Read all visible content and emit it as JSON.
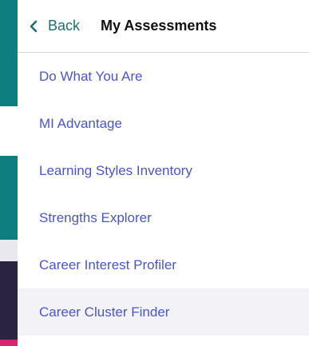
{
  "header": {
    "back_label": "Back",
    "title": "My Assessments",
    "back_icon": "chevron-left-icon"
  },
  "menu": {
    "items": [
      {
        "label": "Do What You Are"
      },
      {
        "label": "MI Advantage"
      },
      {
        "label": "Learning Styles Inventory"
      },
      {
        "label": "Strengths Explorer"
      },
      {
        "label": "Career Interest Profiler"
      },
      {
        "label": "Career Cluster Finder"
      }
    ]
  },
  "colors": {
    "accent": "#1b6f73",
    "link": "#4a55c8",
    "title": "#111111",
    "strip_teal": "#0e7f7e",
    "strip_dark": "#2a2341",
    "strip_pink": "#d6246e"
  }
}
